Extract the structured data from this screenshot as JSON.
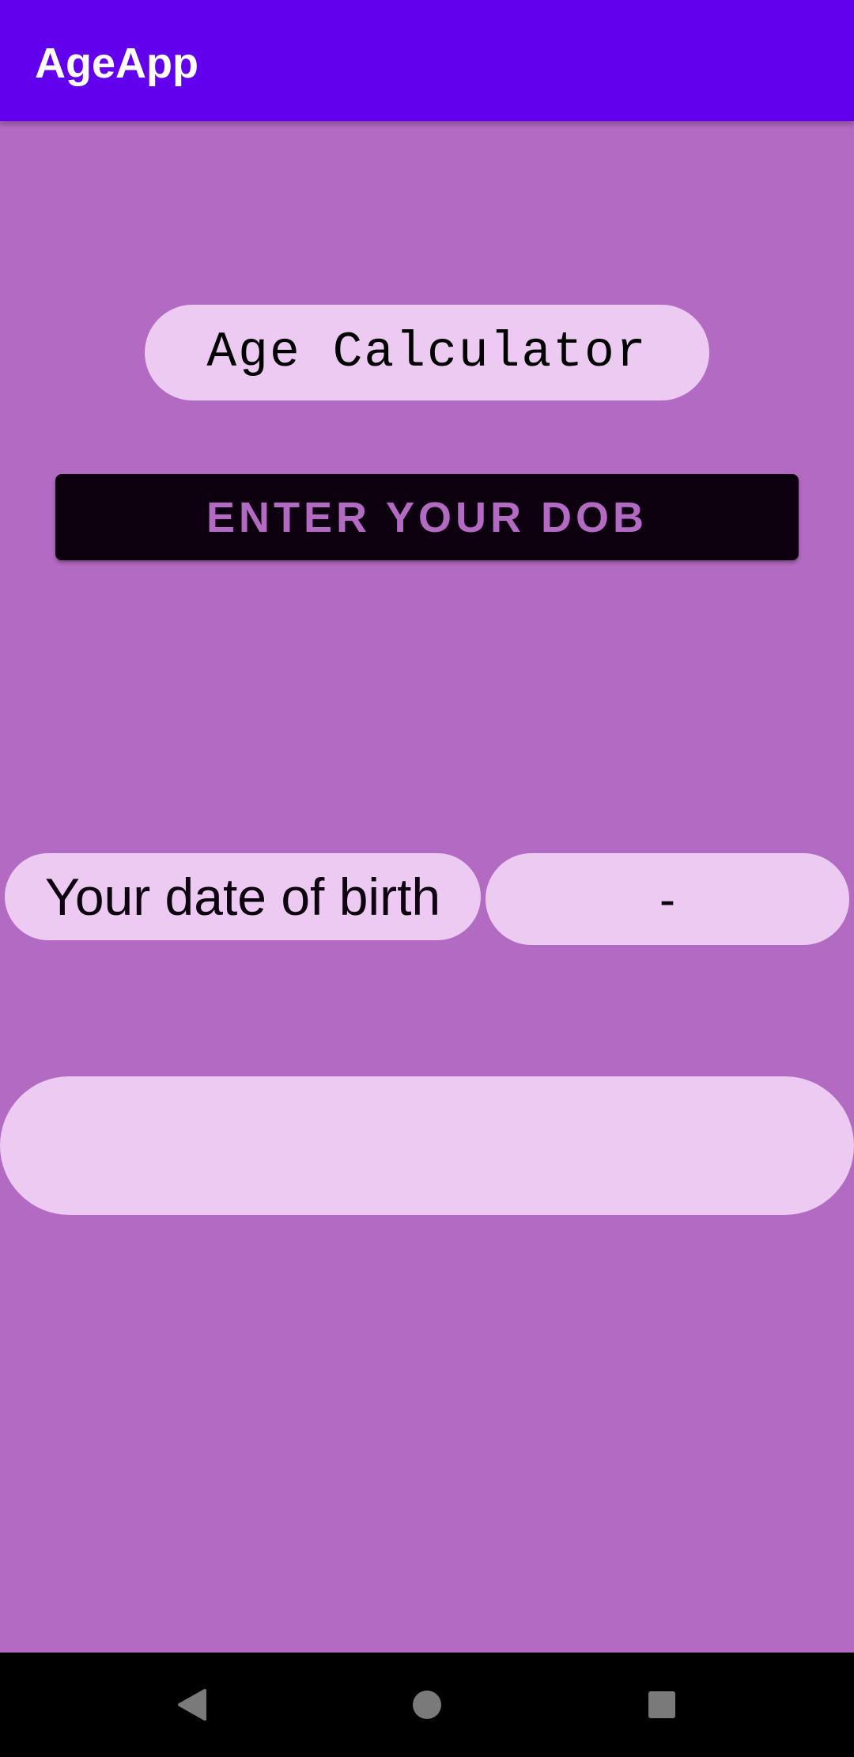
{
  "app_bar": {
    "title": "AgeApp",
    "color": "#6200EE"
  },
  "main": {
    "heading": "Age Calculator",
    "dob_button_label": "ENTER YOUR DOB",
    "dob_label": "Your date of birth",
    "dob_value": "-",
    "result_text": ""
  },
  "colors": {
    "background": "#B36AC2",
    "pill": "#ECCAF2",
    "button": "#0D000F"
  },
  "nav_bar": {
    "icons": [
      "back-icon",
      "home-icon",
      "recents-icon"
    ]
  }
}
